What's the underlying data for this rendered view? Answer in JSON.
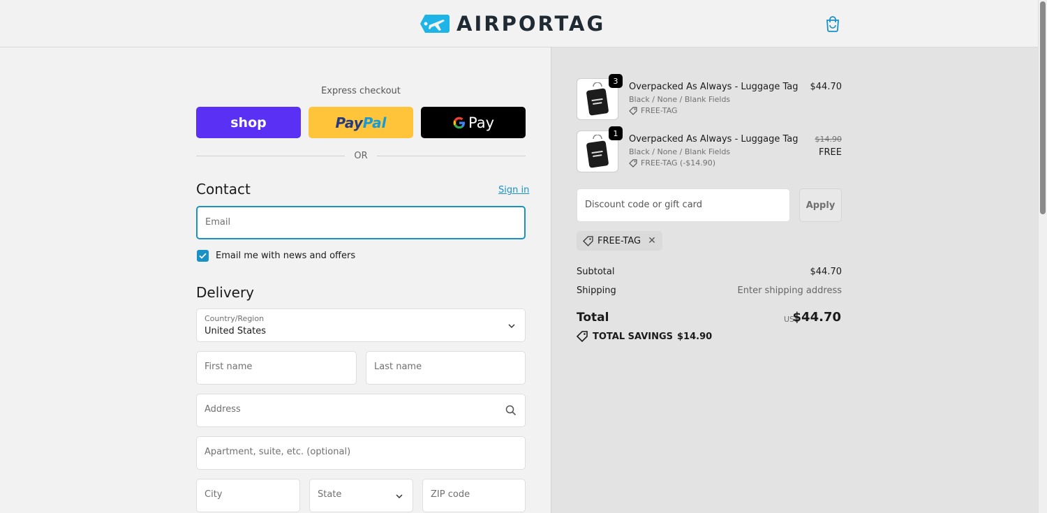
{
  "header": {
    "brand": "AIRPORTAG",
    "cart_icon": "shopping-bag-icon"
  },
  "express": {
    "title": "Express checkout",
    "shop_label": "shop",
    "paypal_label_1": "Pay",
    "paypal_label_2": "Pal",
    "gpay_g": "G",
    "gpay_label": "Pay",
    "or_label": "OR"
  },
  "contact": {
    "title": "Contact",
    "sign_in": "Sign in",
    "email_placeholder": "Email",
    "newsletter_label": "Email me with news and offers",
    "newsletter_checked": true
  },
  "delivery": {
    "title": "Delivery",
    "country_label": "Country/Region",
    "country_value": "United States",
    "first_name_placeholder": "First name",
    "last_name_placeholder": "Last name",
    "address_placeholder": "Address",
    "apartment_placeholder": "Apartment, suite, etc. (optional)",
    "city_placeholder": "City",
    "state_placeholder": "State",
    "zip_placeholder": "ZIP code"
  },
  "order": {
    "items": [
      {
        "name": "Overpacked As Always - Luggage Tag",
        "variant": "Black / None / Blank Fields",
        "discount": "FREE-TAG",
        "qty": "3",
        "price": "$44.70"
      },
      {
        "name": "Overpacked As Always - Luggage Tag",
        "variant": "Black / None / Blank Fields",
        "discount": "FREE-TAG (-$14.90)",
        "qty": "1",
        "price_old": "$14.90",
        "price_new": "FREE"
      }
    ],
    "discount_placeholder": "Discount code or gift card",
    "apply_label": "Apply",
    "applied_code": "FREE-TAG",
    "remove_symbol": "✕",
    "subtotal_label": "Subtotal",
    "subtotal_value": "$44.70",
    "shipping_label": "Shipping",
    "shipping_value": "Enter shipping address",
    "total_label": "Total",
    "total_currency": "USD",
    "total_value": "$44.70",
    "savings_label": "TOTAL SAVINGS",
    "savings_value": "$14.90"
  },
  "colors": {
    "accent": "#1990c6",
    "shop_purple": "#5a31f4",
    "paypal_yellow": "#ffc439"
  }
}
